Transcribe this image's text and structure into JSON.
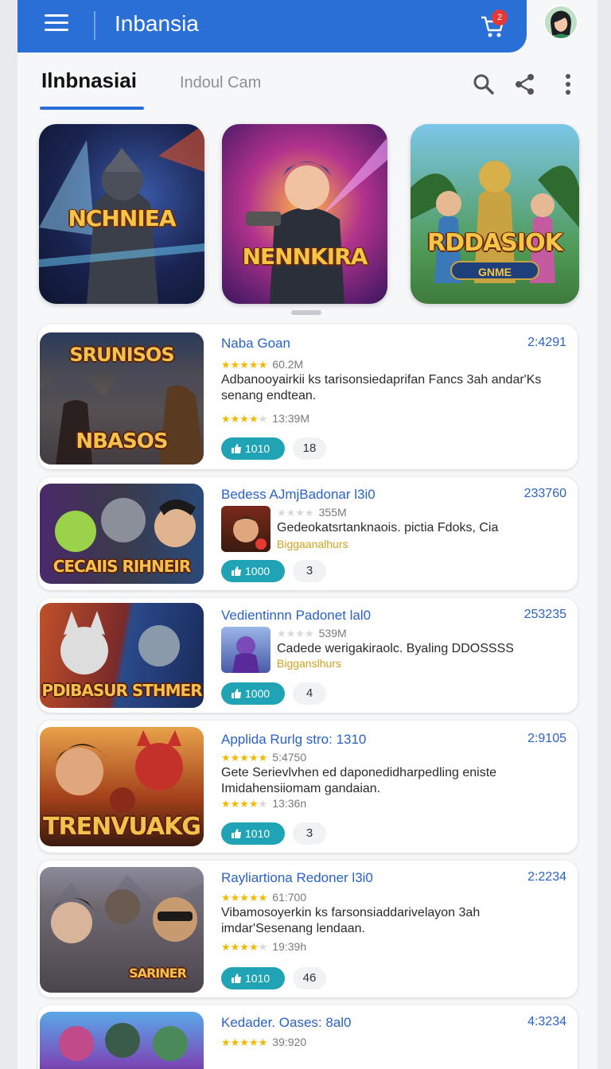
{
  "app": {
    "title": "Inbansia",
    "cart_badge": "2"
  },
  "tabs": [
    {
      "label": "Ilnbnasiai"
    },
    {
      "label": "Indoul Cam"
    }
  ],
  "toolbar_icons": [
    "search-icon",
    "share-icon",
    "more-vert-icon"
  ],
  "featured": [
    {
      "label": "NCHNIEA",
      "sub": ""
    },
    {
      "label": "NENNKIRA",
      "sub": ""
    },
    {
      "label": "RDDASIOK",
      "sub": "GNME"
    }
  ],
  "cards": [
    {
      "title": "Naba Goan",
      "number": "2:4291",
      "rating_count": "60.2M",
      "desc": "Adbanooyairkii ks tarisonsiedaprifan Fancs 3ah andar'Ks senang endtean.",
      "rating2": "13:39M",
      "gold": "",
      "download": "1010",
      "count": "18",
      "thumb_top": "SRUNISOS",
      "thumb_bottom": "NBASOS"
    },
    {
      "title": "Bedess AJmjBadonar l3i0",
      "number": "233760",
      "rating_count": "355M",
      "desc": "Gedeokatsrtanknaois. pictia Fdoks, Cia",
      "rating2": "",
      "gold": "Biggaanalhurs",
      "download": "1000",
      "count": "3",
      "thumb_top": "",
      "thumb_bottom": "CECAIIS  RIHNEIR"
    },
    {
      "title": "Vedientinnn Padonet lal0",
      "number": "253235",
      "rating_count": "539M",
      "desc": "Cadede werigakiraolc. Byaling DDOSSSS",
      "rating2": "",
      "gold": "Bigganslhurs",
      "download": "1000",
      "count": "4",
      "thumb_top": "",
      "thumb_bottom": "PDIBASUR  STHMER"
    },
    {
      "title": "Applida Rurlg stro: 1310",
      "number": "2:9105",
      "rating_count": "5:4750",
      "desc": "Gete Serievlvhen ed daponedidharpedling eniste Imidahensiiomam gandaian.",
      "rating2": "13:36n",
      "gold": "",
      "download": "1010",
      "count": "3",
      "thumb_top": "",
      "thumb_bottom": "TRENVUAKG"
    },
    {
      "title": "Rayliartiona Redoner l3i0",
      "number": "2:2234",
      "rating_count": "61:700",
      "desc": "Vibamosoyerkin ks farsonsiaddarivelayon 3ah imdar'Sesenang lendaan.",
      "rating2": "19:39h",
      "gold": "",
      "download": "1010",
      "count": "46",
      "thumb_top": "",
      "thumb_bottom": "SARINER"
    },
    {
      "title": "Kedader. Oases: 8al0",
      "number": "4:3234",
      "rating_count": "39:920",
      "desc": "",
      "rating2": "",
      "gold": "",
      "download": "",
      "count": "",
      "thumb_top": "",
      "thumb_bottom": ""
    }
  ],
  "colors": {
    "appbar": "#2a6fd6",
    "accent": "#2a63c4",
    "button": "#1fa3b5",
    "star": "#f3b800"
  }
}
